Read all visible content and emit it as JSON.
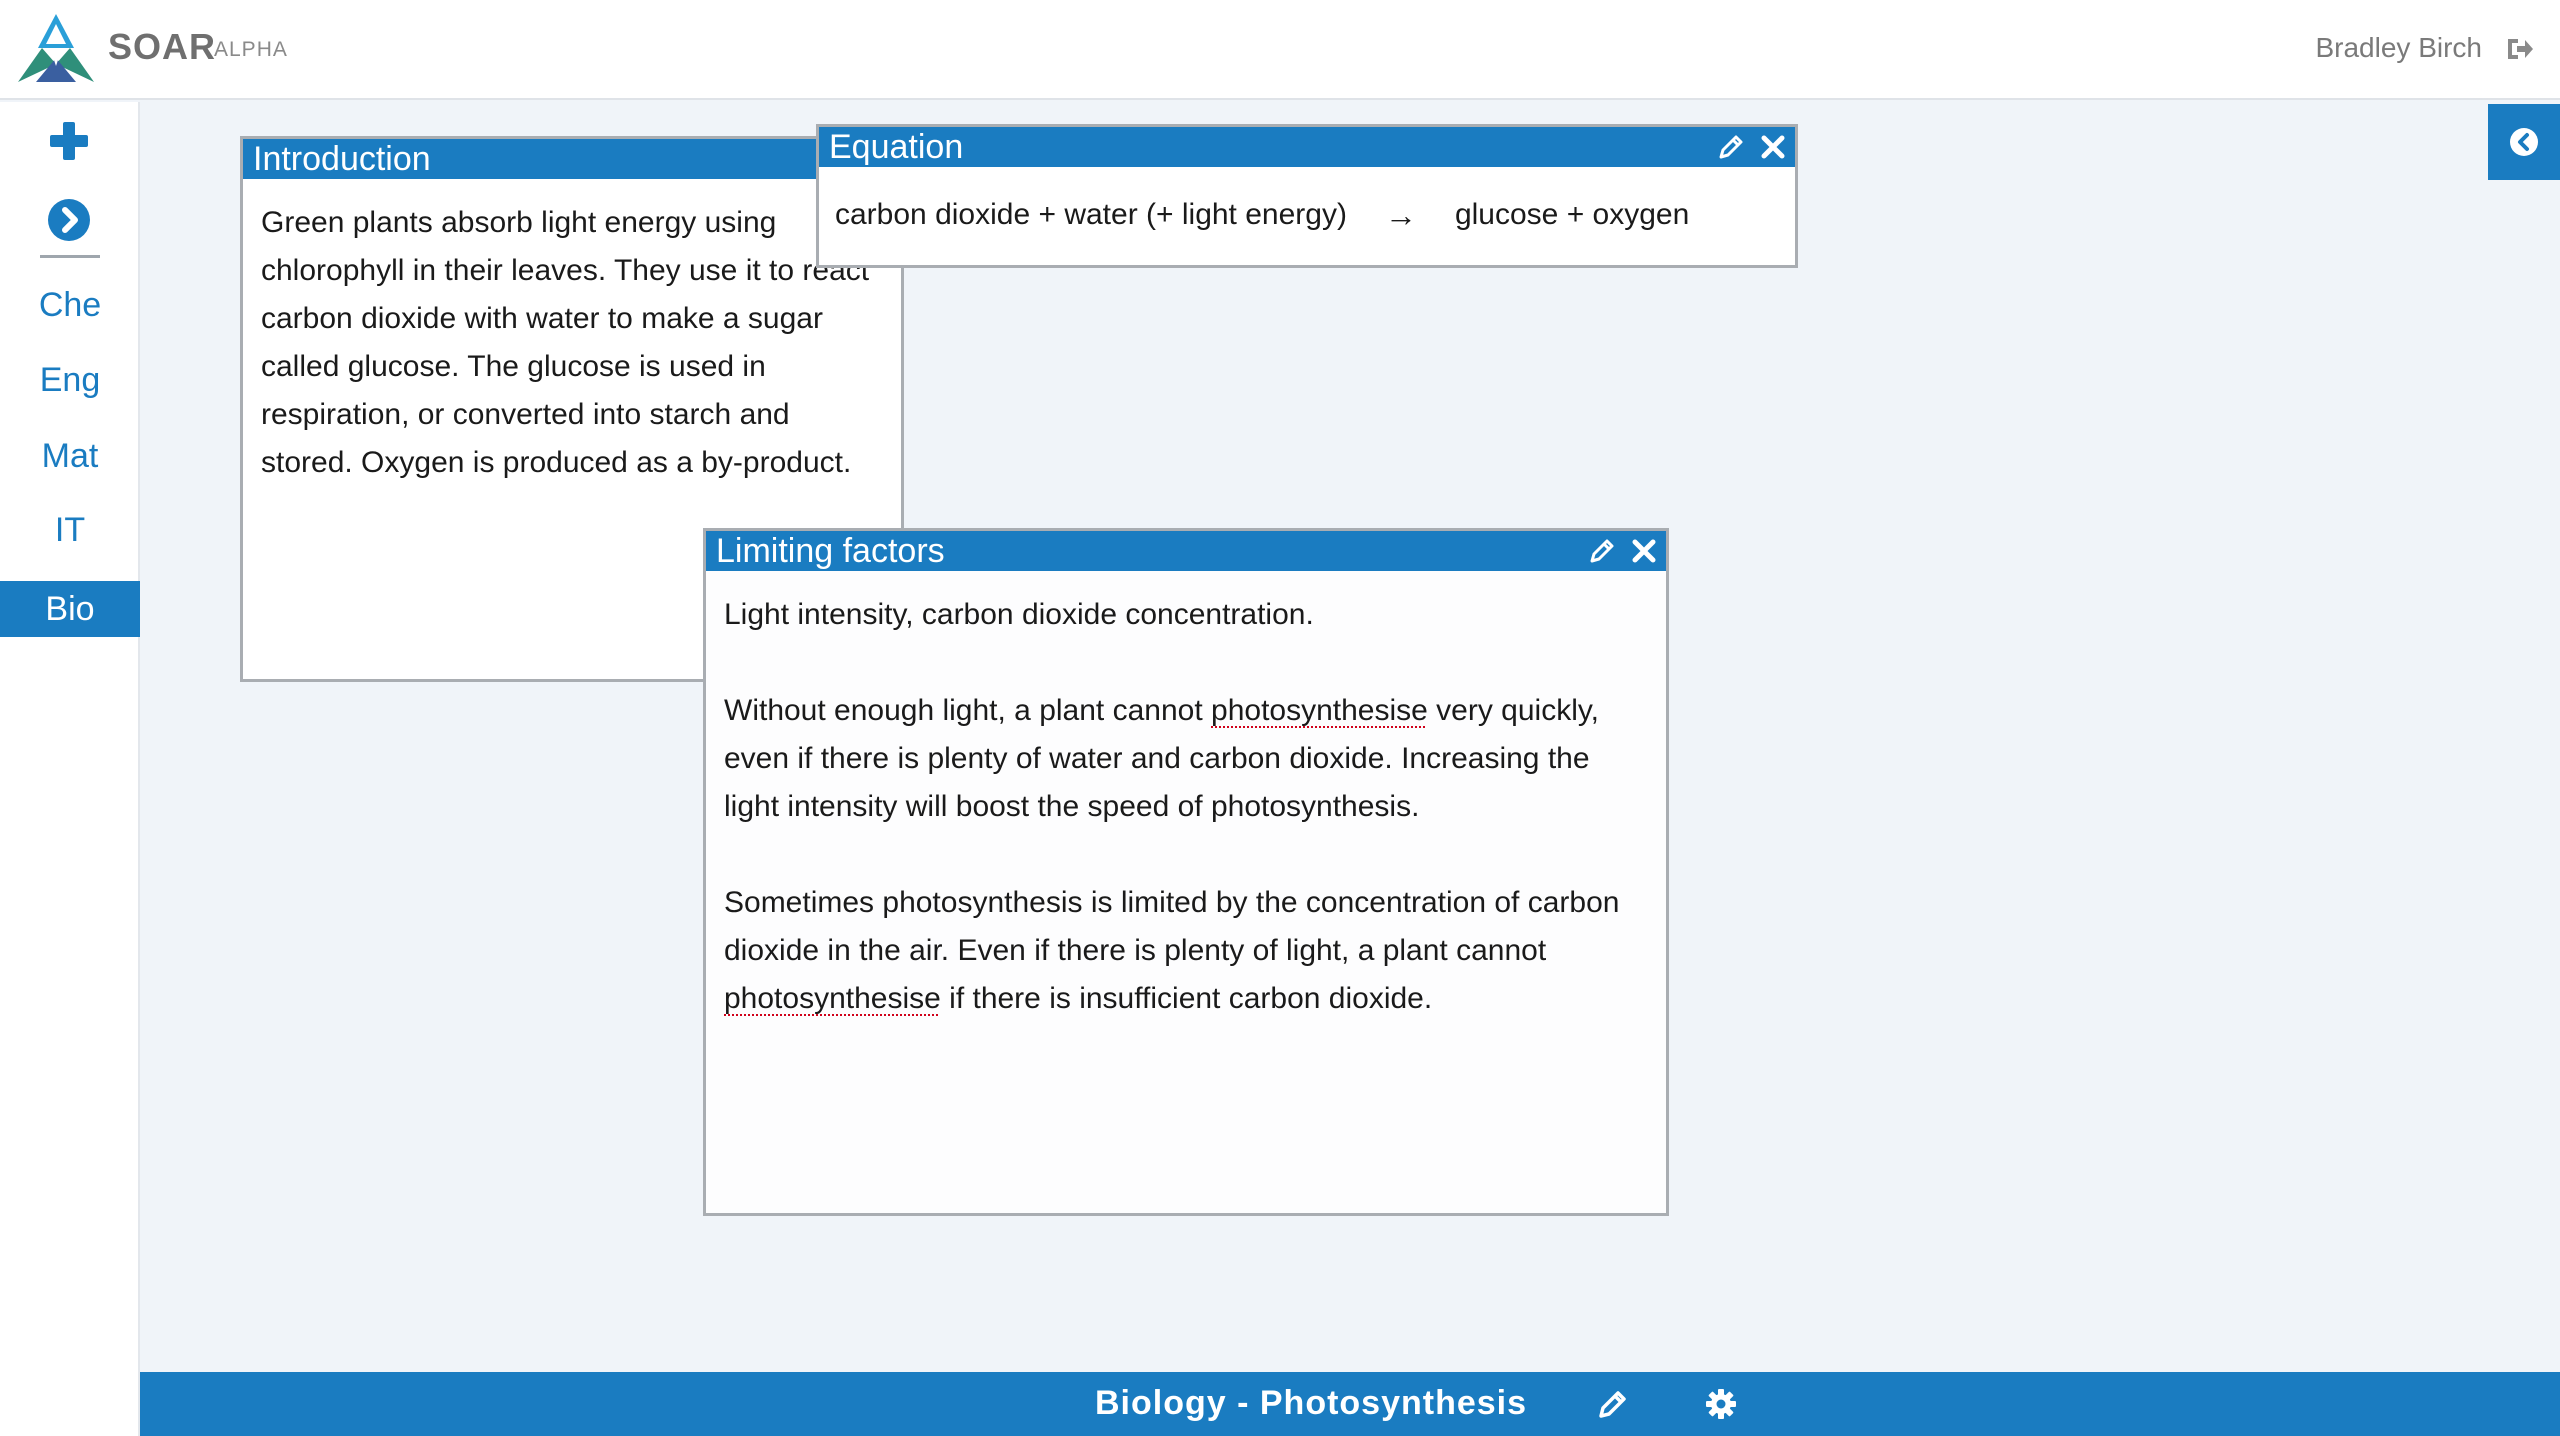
{
  "header": {
    "brand": "SOAR",
    "brand_sub": "ALPHA",
    "user_name": "Bradley Birch"
  },
  "sidebar": {
    "items": [
      {
        "label": "Che",
        "active": false
      },
      {
        "label": "Eng",
        "active": false
      },
      {
        "label": "Mat",
        "active": false
      },
      {
        "label": "IT",
        "active": false
      },
      {
        "label": "Bio",
        "active": true
      }
    ]
  },
  "cards": {
    "introduction": {
      "title": "Introduction",
      "body": "Green plants absorb light energy using chlorophyll in their leaves. They use it to react carbon dioxide with water to make a sugar called glucose. The glucose is used in respiration, or converted into starch and stored. Oxygen is produced as a by-product."
    },
    "equation": {
      "title": "Equation",
      "left": "carbon dioxide + water (+ light energy)",
      "arrow": "→",
      "right": "glucose + oxygen"
    },
    "limiting": {
      "title": "Limiting factors",
      "p1": "Light intensity, carbon dioxide concentration.",
      "p2_a": "Without enough light, a plant cannot ",
      "p2_spell": "photosynthesise",
      "p2_b": " very quickly, even if there is plenty of water and carbon dioxide. Increasing the light intensity will boost the speed of photosynthesis.",
      "p3_a": "Sometimes photosynthesis is limited by the concentration of carbon dioxide in the air. Even if there is plenty of light, a plant cannot ",
      "p3_spell": "photosynthesise",
      "p3_b": " if there is insufficient carbon dioxide."
    }
  },
  "footer": {
    "board_title": "Biology - Photosynthesis"
  },
  "colors": {
    "accent": "#1a7cc1",
    "background": "#f0f4f9",
    "spellcheck": "#d0021b"
  },
  "icons": [
    "soar-logo-icon",
    "logout-icon",
    "plus-icon",
    "chevron-right-circle-icon",
    "chevron-left-circle-icon",
    "pencil-icon",
    "close-icon",
    "gear-icon"
  ]
}
